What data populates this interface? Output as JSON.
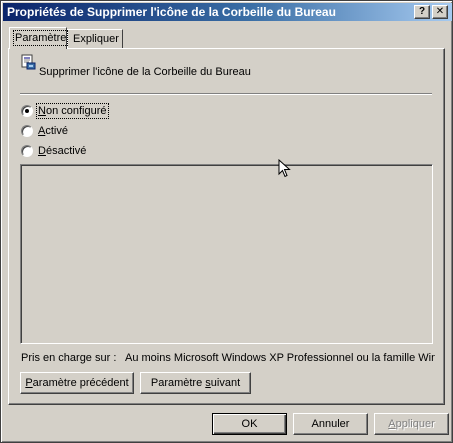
{
  "window": {
    "title": "Propriétés de Supprimer l'icône de la Corbeille du Bureau",
    "help_glyph": "?",
    "close_glyph": "✕"
  },
  "tabs": [
    {
      "label": "Paramètre",
      "active": true
    },
    {
      "label": "Expliquer",
      "active": false
    }
  ],
  "policy": {
    "icon": "policy-setting-icon",
    "name": "Supprimer l'icône de la Corbeille du Bureau"
  },
  "options": {
    "not_configured": {
      "prefix": "",
      "mnemonic": "N",
      "rest": "on configuré",
      "checked": true
    },
    "enabled": {
      "prefix": "",
      "mnemonic": "A",
      "rest": "ctivé",
      "checked": false
    },
    "disabled": {
      "prefix": "",
      "mnemonic": "D",
      "rest": "ésactivé",
      "checked": false
    }
  },
  "support": {
    "label": "Pris en charge sur :",
    "value": "Au moins Microsoft Windows XP Professionnel ou la famille Win..."
  },
  "nav_buttons": {
    "previous": {
      "prefix": "",
      "mnemonic": "P",
      "rest": "aramètre précédent"
    },
    "next": {
      "prefix": "Paramètre ",
      "mnemonic": "s",
      "rest": "uivant"
    }
  },
  "dialog_buttons": {
    "ok": "OK",
    "cancel": "Annuler",
    "apply": {
      "prefix": "",
      "mnemonic": "A",
      "rest": "ppliquer"
    }
  },
  "colors": {
    "face": "#d4d0c8",
    "title_start": "#0a246a",
    "title_end": "#a6caf0"
  }
}
